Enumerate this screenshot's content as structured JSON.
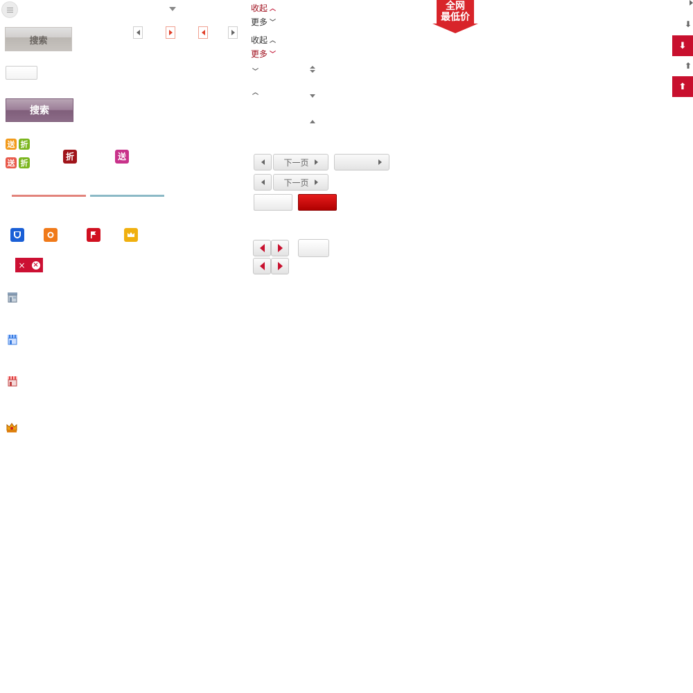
{
  "left": {
    "search_gray_label": "搜索",
    "search_purple_label": "搜索",
    "tags_row1": [
      "送",
      "折"
    ],
    "tags_row2": [
      "送",
      "折"
    ],
    "tag_discount": "折",
    "tag_gift": "送",
    "close_tag_label": "×",
    "close_circle_label": "×"
  },
  "middle": {
    "collapse_label": "收起",
    "more_label": "更多",
    "collapse_label_dark": "收起",
    "more_label_red": "更多",
    "next_page_label": "下一页",
    "next_page_label_2": "下一页"
  },
  "badge": {
    "line1": "全网",
    "line2": "最低价"
  },
  "right": {
    "down_arrow": "⬇",
    "up_arrow": "⬆"
  },
  "colors": {
    "accent_red": "#c8102e",
    "purple_button": "#8c6c88",
    "line_red": "#e2837b",
    "line_teal": "#8bb9c6"
  }
}
